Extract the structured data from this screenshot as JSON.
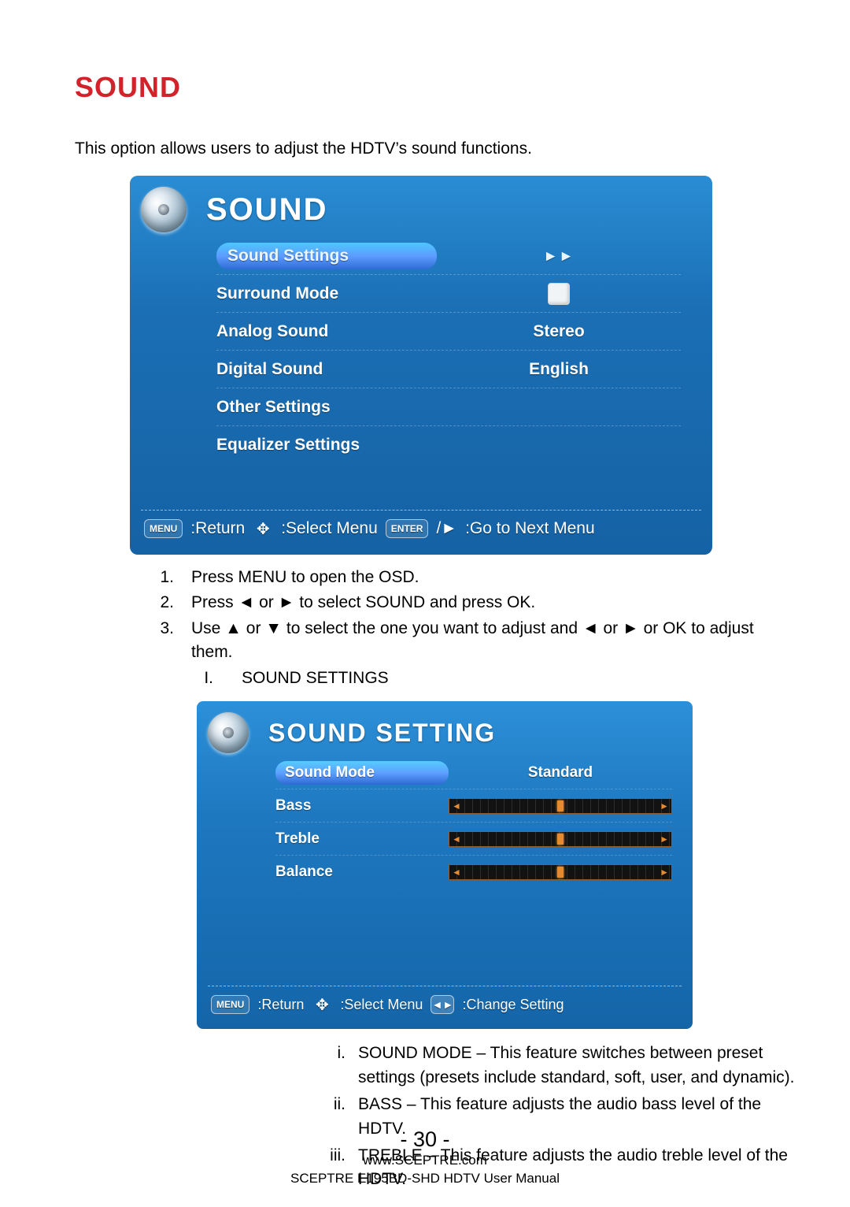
{
  "section_title": "SOUND",
  "intro": "This option allows users to adjust the HDTV’s sound functions.",
  "osd_sound": {
    "title": "SOUND",
    "rows": [
      {
        "label": "Sound Settings",
        "value_type": "arrows"
      },
      {
        "label": "Surround Mode",
        "value_type": "checkbox"
      },
      {
        "label": "Analog Sound",
        "value_type": "text",
        "value": "Stereo"
      },
      {
        "label": "Digital Sound",
        "value_type": "text",
        "value": "English"
      },
      {
        "label": "Other Settings",
        "value_type": "none"
      },
      {
        "label": "Equalizer Settings",
        "value_type": "none"
      }
    ],
    "arrows_glyph": "►►",
    "footer": {
      "return_key": "MENU",
      "return_label": ":Return",
      "select_label": ":Select Menu",
      "enter_key": "ENTER",
      "arrow_glyph": "/►",
      "next_label": ":Go to Next Menu"
    }
  },
  "steps": {
    "1": "Press MENU to open the OSD.",
    "2": "Press ◄ or ► to select SOUND and press OK.",
    "3": "Use ▲ or ▼ to select the one you want to adjust and ◄ or ► or OK to adjust them.",
    "3_I_label": "I.",
    "3_I_text": "SOUND SETTINGS"
  },
  "osd_setting": {
    "title": "SOUND SETTING",
    "rows": [
      {
        "label": "Sound Mode",
        "type": "text",
        "value": "Standard"
      },
      {
        "label": "Bass",
        "type": "slider"
      },
      {
        "label": "Treble",
        "type": "slider"
      },
      {
        "label": "Balance",
        "type": "slider"
      }
    ],
    "footer": {
      "return_key": "MENU",
      "return_label": ":Return",
      "select_label": ":Select Menu",
      "lr_glyph": "◄►",
      "change_label": ":Change Setting"
    }
  },
  "roman": {
    "i": "SOUND MODE – This feature switches between preset settings (presets include standard, soft, user, and dynamic).",
    "ii": "BASS – This feature adjusts the audio bass level of the HDTV.",
    "iii": "TREBLE – This feature adjusts the audio treble level of the HDTV."
  },
  "page_number": "- 30 -",
  "footer_url": "www.SCEPTRE.com",
  "footer_manual": "SCEPTRE E195BD-SHD HDTV User Manual"
}
